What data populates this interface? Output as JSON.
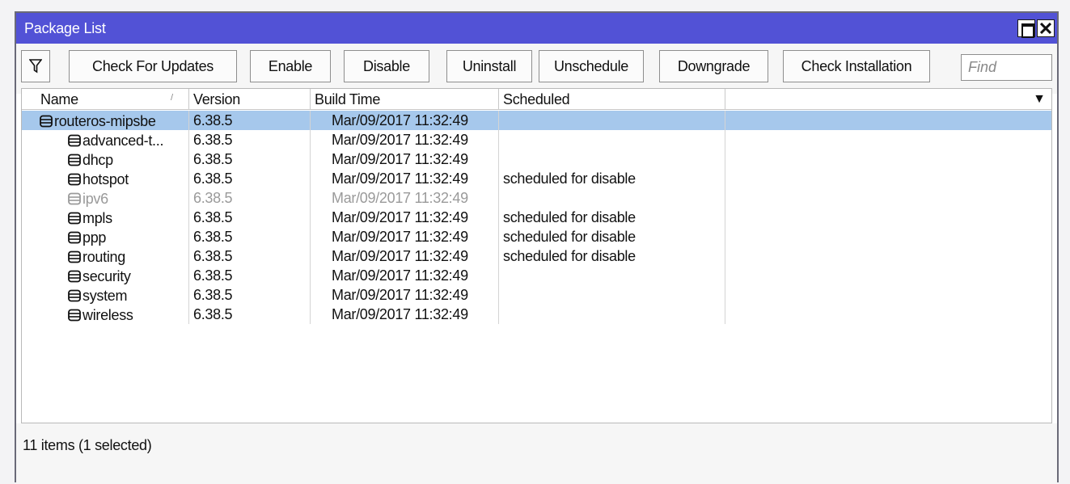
{
  "window": {
    "title": "Package List"
  },
  "toolbar": {
    "buttons": [
      {
        "id": "check-for-updates",
        "label": "Check For Updates"
      },
      {
        "id": "enable",
        "label": "Enable"
      },
      {
        "id": "disable",
        "label": "Disable"
      },
      {
        "id": "uninstall",
        "label": "Uninstall"
      },
      {
        "id": "unschedule",
        "label": "Unschedule"
      },
      {
        "id": "downgrade",
        "label": "Downgrade"
      },
      {
        "id": "check-installation",
        "label": "Check Installation"
      }
    ],
    "find_placeholder": "Find"
  },
  "table": {
    "columns": [
      "Name",
      "Version",
      "Build Time",
      "Scheduled"
    ],
    "rows": [
      {
        "name": "routeros-mipsbe",
        "version": "6.38.5",
        "build_time": "Mar/09/2017 11:32:49",
        "scheduled": "",
        "selected": true,
        "disabled": false,
        "level": 0
      },
      {
        "name": "advanced-t...",
        "version": "6.38.5",
        "build_time": "Mar/09/2017 11:32:49",
        "scheduled": "",
        "selected": false,
        "disabled": false,
        "level": 1
      },
      {
        "name": "dhcp",
        "version": "6.38.5",
        "build_time": "Mar/09/2017 11:32:49",
        "scheduled": "",
        "selected": false,
        "disabled": false,
        "level": 1
      },
      {
        "name": "hotspot",
        "version": "6.38.5",
        "build_time": "Mar/09/2017 11:32:49",
        "scheduled": "scheduled for disable",
        "selected": false,
        "disabled": false,
        "level": 1
      },
      {
        "name": "ipv6",
        "version": "6.38.5",
        "build_time": "Mar/09/2017 11:32:49",
        "scheduled": "",
        "selected": false,
        "disabled": true,
        "level": 1
      },
      {
        "name": "mpls",
        "version": "6.38.5",
        "build_time": "Mar/09/2017 11:32:49",
        "scheduled": "scheduled for disable",
        "selected": false,
        "disabled": false,
        "level": 1
      },
      {
        "name": "ppp",
        "version": "6.38.5",
        "build_time": "Mar/09/2017 11:32:49",
        "scheduled": "scheduled for disable",
        "selected": false,
        "disabled": false,
        "level": 1
      },
      {
        "name": "routing",
        "version": "6.38.5",
        "build_time": "Mar/09/2017 11:32:49",
        "scheduled": "scheduled for disable",
        "selected": false,
        "disabled": false,
        "level": 1
      },
      {
        "name": "security",
        "version": "6.38.5",
        "build_time": "Mar/09/2017 11:32:49",
        "scheduled": "",
        "selected": false,
        "disabled": false,
        "level": 1
      },
      {
        "name": "system",
        "version": "6.38.5",
        "build_time": "Mar/09/2017 11:32:49",
        "scheduled": "",
        "selected": false,
        "disabled": false,
        "level": 1
      },
      {
        "name": "wireless",
        "version": "6.38.5",
        "build_time": "Mar/09/2017 11:32:49",
        "scheduled": "",
        "selected": false,
        "disabled": false,
        "level": 1
      }
    ]
  },
  "status": {
    "text": "11 items (1 selected)"
  },
  "icons": {
    "filter": "filter-icon",
    "package": "package-icon",
    "maximize": "maximize-icon",
    "close": "close-icon",
    "column_menu": "chevron-down-icon"
  },
  "colors": {
    "titlebar": "#5252d6",
    "selection": "#a6c8ec",
    "disabled_text": "#9a9a9a"
  }
}
